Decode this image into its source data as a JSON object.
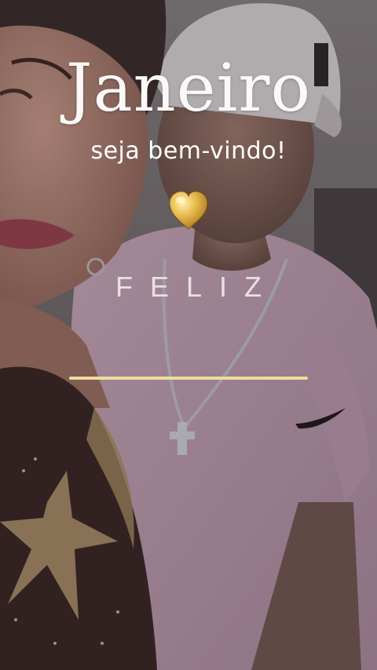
{
  "story": {
    "title": "Janeiro",
    "subtitle": "seja bem-vindo!",
    "word": "FELIZ",
    "heart_icon": "gold-heart-icon"
  },
  "colors": {
    "divider": "#f0dc9c",
    "title_text": "#fbf8f8",
    "heart_gold": "#d9a93a"
  }
}
